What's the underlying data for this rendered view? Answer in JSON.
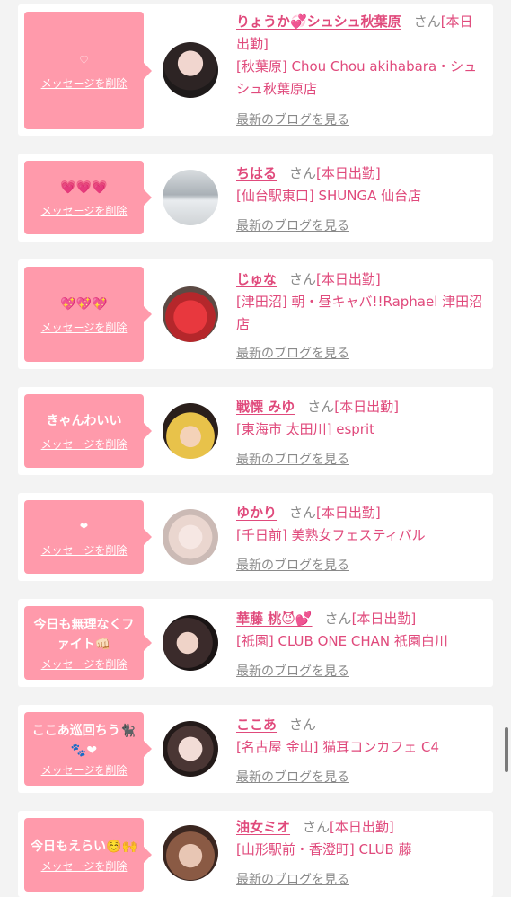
{
  "delete_label": "メッセージを削除",
  "blog_label": "最新のブログを見る",
  "honorific": "さん",
  "entries": [
    {
      "message": "♡",
      "name": "りょうか💞シュシュ秋葉原",
      "status": "[本日出勤]",
      "shop": "[秋葉原] Chou Chou akihabara・シュシュ秋葉原店"
    },
    {
      "message": "💗💗💗",
      "name": "ちはる",
      "status": "[本日出勤]",
      "shop": "[仙台駅東口] SHUNGA 仙台店"
    },
    {
      "message": "💖💖💖",
      "name": "じゅな",
      "status": "[本日出勤]",
      "shop": "[津田沼] 朝・昼キャバ!!Raphael 津田沼店"
    },
    {
      "message": "きゃんわいい",
      "name": "戦慄 みゆ",
      "status": "[本日出勤]",
      "shop": "[東海市 太田川] esprit"
    },
    {
      "message": "❤",
      "name": "ゆかり",
      "status": "[本日出勤]",
      "shop": "[千日前] 美熟女フェスティバル"
    },
    {
      "message": "今日も無理なくファイト👊🏻",
      "name": "華藤 桃😈💕",
      "status": "[本日出勤]",
      "shop": "[祇園] CLUB ONE CHAN 祇園白川"
    },
    {
      "message": "ここあ巡回ちう🐈‍⬛🐾❤",
      "name": "ここあ",
      "status": "",
      "shop": "[名古屋 金山] 猫耳コンカフェ C4"
    },
    {
      "message": "今日もえらい☺️🙌",
      "name": "油女ミオ",
      "status": "[本日出勤]",
      "shop": "[山形駅前・香澄町] CLUB 藤"
    }
  ]
}
